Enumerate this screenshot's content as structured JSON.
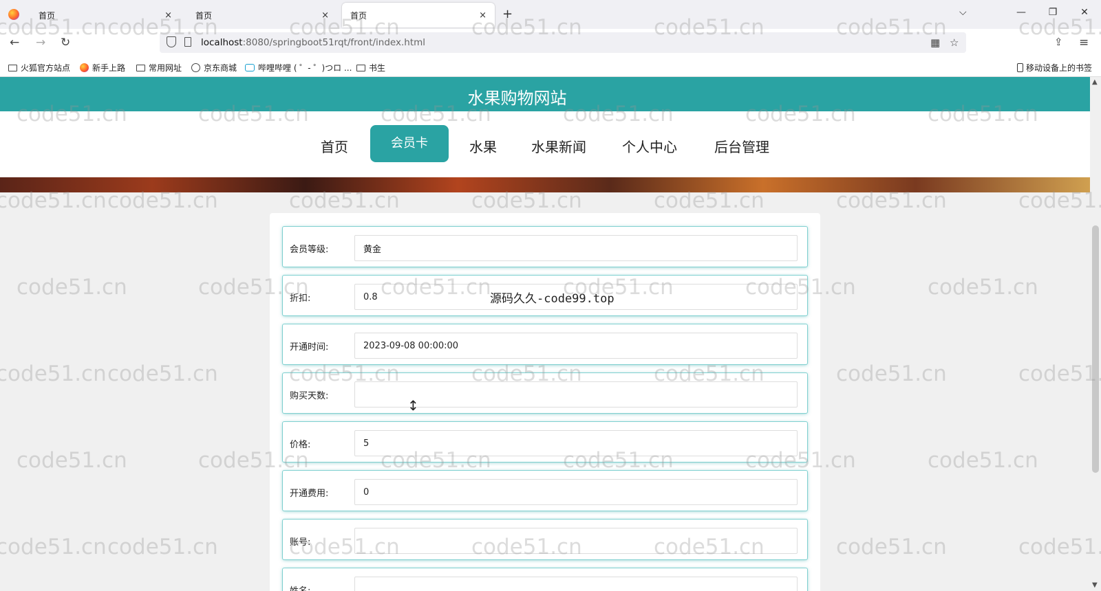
{
  "browser": {
    "tabs": [
      {
        "title": "首页",
        "close": "×"
      },
      {
        "title": "首页",
        "close": "×"
      },
      {
        "title": "首页",
        "close": "×"
      }
    ],
    "new_tab": "+",
    "tab_list": "⌵",
    "window_controls": {
      "minimize": "—",
      "restore": "❐",
      "close": "✕"
    },
    "nav": {
      "back": "←",
      "forward": "→",
      "reload": "↻"
    },
    "url": {
      "host": "localhost",
      "rest": ":8080/springboot51rqt/front/index.html"
    },
    "url_icons": {
      "qr": "▦",
      "star": "☆"
    },
    "toolbar_icons": {
      "extensions": "⇪",
      "menu": "≡"
    },
    "bookmarks": [
      {
        "label": "火狐官方站点",
        "icon": "folder-icon"
      },
      {
        "label": "新手上路",
        "icon": "firefox-icon"
      },
      {
        "label": "常用网址",
        "icon": "folder-icon"
      },
      {
        "label": "京东商城",
        "icon": "globe-icon"
      },
      {
        "label": "哔哩哔哩 ( ゜- ゜)つロ ...",
        "icon": "tv-icon"
      },
      {
        "label": "书生",
        "icon": "folder-icon"
      }
    ],
    "mobile_bookmarks": "移动设备上的书签"
  },
  "site": {
    "title": "水果购物网站",
    "menu": [
      {
        "label": "首页",
        "active": false
      },
      {
        "label": "会员卡",
        "active": true
      },
      {
        "label": "水果",
        "active": false
      },
      {
        "label": "水果新闻",
        "active": false
      },
      {
        "label": "个人中心",
        "active": false
      },
      {
        "label": "后台管理",
        "active": false
      }
    ],
    "accent_color": "#2aa3a3"
  },
  "form": {
    "fields": [
      {
        "label": "会员等级:",
        "value": ""
      },
      {
        "label": "折扣:",
        "value": "0.8"
      },
      {
        "label": "开通时间:",
        "value": "2023-09-08 00:00:00"
      },
      {
        "label": "购买天数:",
        "value": ""
      },
      {
        "label": "价格:",
        "value": "5"
      },
      {
        "label": "开通费用:",
        "value": "0"
      },
      {
        "label": "账号:",
        "value": ""
      },
      {
        "label": "姓名:",
        "value": ""
      }
    ],
    "first_value": "黄金"
  },
  "overlay": "源码久久-code99.top",
  "watermark": "code51.cn",
  "scroll": {
    "up": "▲",
    "down": "▼"
  },
  "cursor": "↕"
}
